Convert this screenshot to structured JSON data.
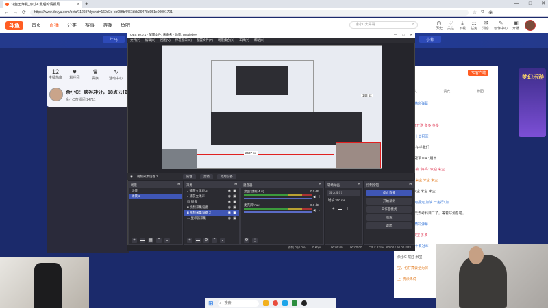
{
  "browser": {
    "tab_title": "斗鱼王炸机_余小C最后的情报局",
    "url": "https://www.douyu.com/beta/11269?dyshid=160d7d-bb05ffb4461bbb26478d051e00091701",
    "nav_back": "←",
    "nav_forward": "→",
    "nav_reload": "⟳",
    "nav_home": "⌂"
  },
  "site": {
    "logo": "斗鱼",
    "nav": [
      "首页",
      "直播",
      "分类",
      "赛事",
      "游戏",
      "鱼吧"
    ],
    "search_placeholder": "余小C大哥哥",
    "header_icons": [
      {
        "icon": "history-icon",
        "label": "历史"
      },
      {
        "icon": "follow-icon",
        "label": "关注"
      },
      {
        "icon": "download-icon",
        "label": "下载"
      },
      {
        "icon": "task-icon",
        "label": "任务"
      },
      {
        "icon": "message-icon",
        "label": "消息"
      },
      {
        "icon": "creator-icon",
        "label": "创作中心"
      },
      {
        "icon": "live-icon",
        "label": "开播"
      }
    ],
    "banner_tags": [
      "年马",
      "小都"
    ]
  },
  "streamer": {
    "stats": [
      {
        "num": "12",
        "label": "主播热度"
      },
      {
        "num": "",
        "label": "粉丝团"
      },
      {
        "num": "",
        "label": "贵族"
      },
      {
        "num": "",
        "label": "活动中心"
      }
    ],
    "title": "余小C：峡谷冲分，18点云顶",
    "subtitle": "余小C直播间  14711"
  },
  "rightpanel": {
    "pc_button": "PC客户端",
    "tabs": [
      "送礼",
      "贵宾",
      "粉团"
    ],
    "promo": "梦幻乐游",
    "chat": [
      {
        "badge": "",
        "text": "今日无提升精彩弹幕",
        "cls": "blue"
      },
      {
        "badge": "",
        "text": "精彩活动日",
        "cls": "blue"
      },
      {
        "badge": "30",
        "text": "主人 打开送 多多 多多",
        "cls": "red"
      },
      {
        "badge": "",
        "text": "神猫king 李十岁冠军",
        "cls": "blue"
      },
      {
        "badge": "21",
        "text": "我们不在乎我们",
        "cls": ""
      },
      {
        "badge": "",
        "text": "光小毛十名冠军104 : 朋本",
        "cls": ""
      },
      {
        "badge": "28",
        "text": "斗鱼不会 \"好吗\" 欢迎 来宝",
        "cls": "red"
      },
      {
        "badge": "",
        "text": "余小C 欢迎 来宝 米宝 米宝",
        "cls": "orange"
      },
      {
        "badge": "19",
        "text": "欢迎 来宝 米宝 米宝",
        "cls": ""
      },
      {
        "badge": "",
        "text": "你一开局利用拐走 加油 一定行! 加",
        "cls": "blue"
      },
      {
        "badge": "",
        "text": "余小C 看今天去考科目二了。等着好消息吧。",
        "cls": ""
      },
      {
        "badge": "",
        "text": "今日无提升精彩弹幕",
        "cls": "blue"
      },
      {
        "badge": "22",
        "text": "欢迎 来宝 多多",
        "cls": "red"
      },
      {
        "badge": "",
        "text": "神猫king 李十岁冠军",
        "cls": "blue"
      },
      {
        "badge": "",
        "text": "余小C 欢迎 米宝",
        "cls": ""
      },
      {
        "badge": "",
        "text": "宝，也打算去全为保",
        "cls": "orange"
      },
      {
        "badge": "",
        "text": "上! 洗澡再说",
        "cls": "orange"
      }
    ]
  },
  "obs": {
    "title": "OBS 30.0.1 - 配置文件: 未命名 - 场景: Untitled##",
    "menu": [
      "文件(F)",
      "编辑(E)",
      "视图(V)",
      "停靠窗口(D)",
      "配置文件(P)",
      "场景集合(S)",
      "工具(T)",
      "帮助(H)"
    ],
    "px_label_w": "2637 px",
    "px_label_h": "148 px",
    "source_bar": {
      "current": "视频采集设备 2",
      "props": "属性",
      "filters": "滤镜",
      "deactivate": "停用设备"
    },
    "scenes": {
      "title": "场景",
      "items": [
        "场景",
        "场景 2"
      ],
      "selected": 1
    },
    "sources": {
      "title": "来源",
      "items": [
        "捕获立体声 2",
        "捕获立体声",
        "图像",
        "视频采集设备",
        "视频采集设备 2",
        "显示器采集"
      ],
      "selected": 4
    },
    "mixer": {
      "title": "混音器",
      "channels": [
        {
          "name": "桌面音频(Mux)",
          "db": "0.0 dB"
        },
        {
          "name": "麦克风/Aux",
          "db": "0.0 dB"
        }
      ]
    },
    "transitions": {
      "title": "转场动画",
      "type": "淡入淡出",
      "duration_label": "时长",
      "duration": "300 ms"
    },
    "controls": {
      "title": "控制按钮",
      "buttons": [
        "停止直播",
        "开始录制",
        "工作室模式",
        "设置",
        "退出"
      ]
    },
    "status": {
      "dropped": "丢帧 0 (0.0%)",
      "bitrate": "0 kbps",
      "rec": "00:00:00",
      "live": "00:00:00",
      "cpu": "CPU: 2.1%",
      "fps": "60.00 / 60.00 FPS"
    }
  },
  "taskbar": {
    "search_placeholder": "搜索"
  }
}
